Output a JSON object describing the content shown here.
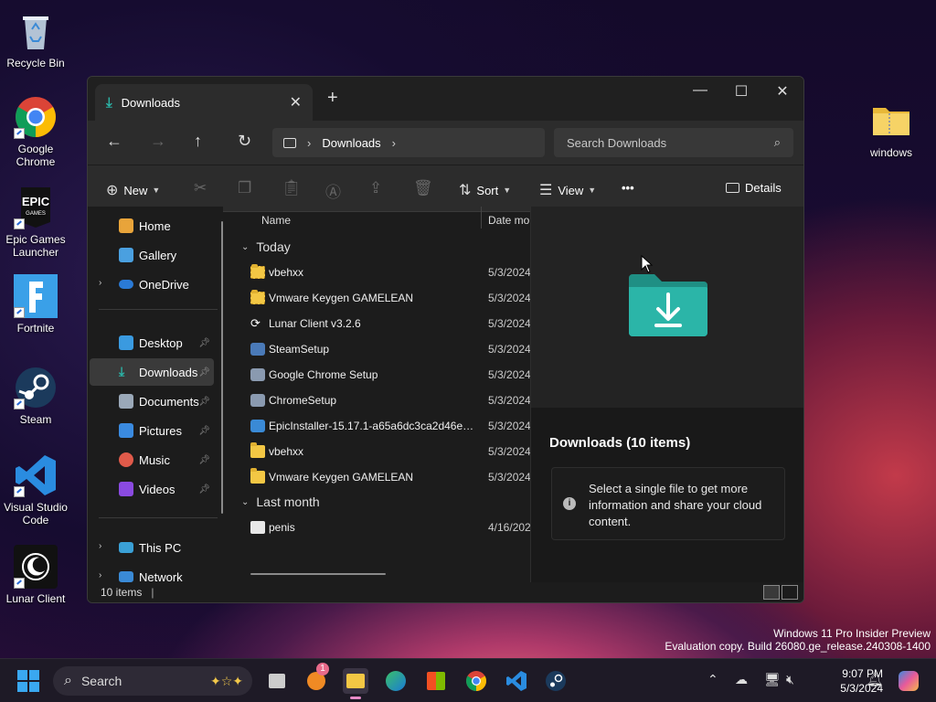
{
  "desktop": {
    "icons": [
      {
        "label": "Recycle Bin",
        "icon": "recycle-bin-icon"
      },
      {
        "label": "Google Chrome",
        "icon": "chrome-icon"
      },
      {
        "label": "Epic Games Launcher",
        "icon": "epic-games-icon"
      },
      {
        "label": "Fortnite",
        "icon": "fortnite-icon"
      },
      {
        "label": "Steam",
        "icon": "steam-icon"
      },
      {
        "label": "Visual Studio Code",
        "icon": "vscode-icon"
      },
      {
        "label": "Lunar Client",
        "icon": "lunar-client-icon"
      },
      {
        "label": "windows",
        "icon": "zip-folder-icon"
      }
    ],
    "watermark": {
      "line1": "Windows 11 Pro Insider Preview",
      "line2": "Evaluation copy. Build 26080.ge_release.240308-1400"
    }
  },
  "window": {
    "tab_title": "Downloads",
    "new_tab": "+",
    "controls": {
      "minimize": "—",
      "maximize": "☐",
      "close": "✕"
    },
    "address": {
      "root_icon": "this-pc-icon",
      "segment": "Downloads"
    },
    "search_placeholder": "Search Downloads",
    "command_bar": {
      "new": "New",
      "sort": "Sort",
      "view": "View",
      "more": "•••",
      "details": "Details"
    },
    "sidebar": {
      "items": [
        {
          "label": "Home",
          "icon": "home-icon"
        },
        {
          "label": "Gallery",
          "icon": "gallery-icon"
        },
        {
          "label": "OneDrive",
          "icon": "onedrive-icon"
        },
        {
          "label": "Desktop",
          "icon": "desktop-icon"
        },
        {
          "label": "Downloads",
          "icon": "downloads-icon"
        },
        {
          "label": "Documents",
          "icon": "documents-icon"
        },
        {
          "label": "Pictures",
          "icon": "pictures-icon"
        },
        {
          "label": "Music",
          "icon": "music-icon"
        },
        {
          "label": "Videos",
          "icon": "videos-icon"
        },
        {
          "label": "This PC",
          "icon": "this-pc-icon"
        },
        {
          "label": "Network",
          "icon": "network-icon"
        }
      ]
    },
    "columns": {
      "name": "Name",
      "date": "Date mo"
    },
    "groups": {
      "today": "Today",
      "last_month": "Last month"
    },
    "files": [
      {
        "name": "vbehxx",
        "date": "5/3/2024",
        "type": "zip-folder"
      },
      {
        "name": "Vmware Keygen GAMELEAN",
        "date": "5/3/2024",
        "type": "zip-folder"
      },
      {
        "name": "Lunar Client v3.2.6",
        "date": "5/3/2024",
        "type": "installer"
      },
      {
        "name": "SteamSetup",
        "date": "5/3/2024",
        "type": "installer"
      },
      {
        "name": "Google Chrome Setup",
        "date": "5/3/2024",
        "type": "installer"
      },
      {
        "name": "ChromeSetup",
        "date": "5/3/2024",
        "type": "installer"
      },
      {
        "name": "EpicInstaller-15.17.1-a65a6dc3ca2d46e3b...",
        "date": "5/3/2024",
        "type": "msi"
      },
      {
        "name": "vbehxx",
        "date": "5/3/2024",
        "type": "folder"
      },
      {
        "name": "Vmware Keygen GAMELEAN",
        "date": "5/3/2024",
        "type": "folder"
      }
    ],
    "last_month_files": [
      {
        "name": "penis",
        "date": "4/16/202",
        "type": "image"
      }
    ],
    "details_pane": {
      "title": "Downloads (10 items)",
      "info": "Select a single file to get more information and share your cloud content."
    },
    "status": "10 items"
  },
  "taskbar": {
    "search_label": "Search",
    "notification_badge": "1",
    "time": "9:07 PM",
    "date": "5/3/2024"
  },
  "colors": {
    "accent_teal": "#2bb5a8",
    "folder_yellow": "#f3c744",
    "window_bg": "#1c1c1c"
  }
}
